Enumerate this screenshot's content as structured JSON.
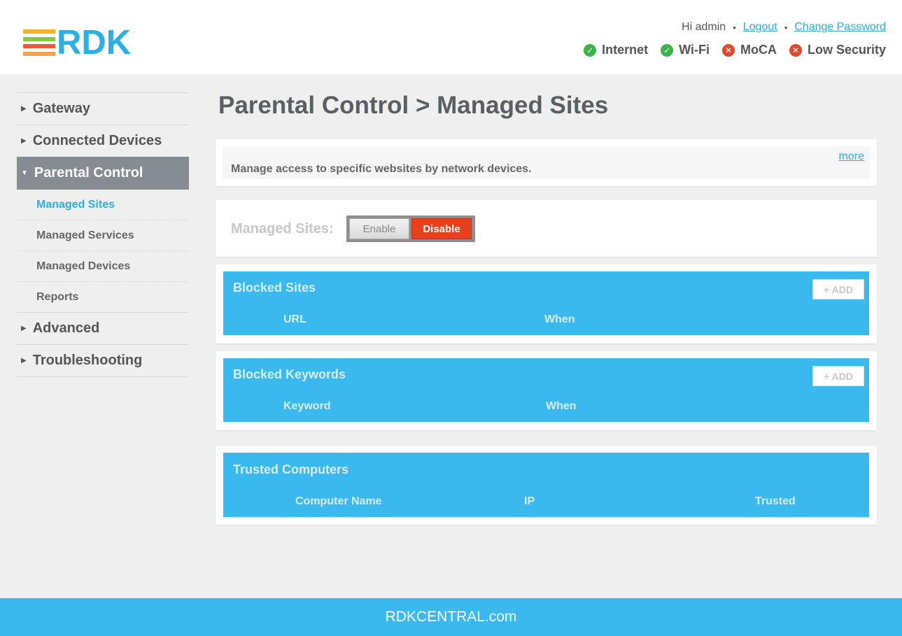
{
  "header": {
    "logo_text": "RDK",
    "logo_colors": [
      "#f7b21d",
      "#8cc63e",
      "#ee5a35",
      "#f4a34a"
    ],
    "greeting": "Hi admin",
    "logout": "Logout",
    "change_password": "Change Password",
    "separator": "•",
    "status": [
      {
        "label": "Internet",
        "state": "ok",
        "icon": "check-circle-icon",
        "color": "#3cb34a"
      },
      {
        "label": "Wi-Fi",
        "state": "ok",
        "icon": "check-circle-icon",
        "color": "#3cb34a"
      },
      {
        "label": "MoCA",
        "state": "error",
        "icon": "x-circle-icon",
        "color": "#e2472d"
      },
      {
        "label": "Low Security",
        "state": "error",
        "icon": "x-circle-icon",
        "color": "#e2472d"
      }
    ]
  },
  "sidebar": {
    "gateway": "Gateway",
    "connected_devices": "Connected Devices",
    "parental_control": "Parental Control",
    "sub": {
      "managed_sites": "Managed Sites",
      "managed_services": "Managed Services",
      "managed_devices": "Managed Devices",
      "reports": "Reports"
    },
    "advanced": "Advanced",
    "troubleshooting": "Troubleshooting"
  },
  "main": {
    "title": "Parental Control > Managed Sites",
    "intro": "Manage access to specific websites by network devices.",
    "more": "more",
    "toggle": {
      "label": "Managed Sites:",
      "enable": "Enable",
      "disable": "Disable",
      "selected": "Disable"
    },
    "blocked_sites": {
      "title": "Blocked Sites",
      "add": "+ ADD",
      "columns": [
        "URL",
        "When"
      ]
    },
    "blocked_keywords": {
      "title": "Blocked Keywords",
      "add": "+ ADD",
      "columns": [
        "Keyword",
        "When"
      ]
    },
    "trusted_computers": {
      "title": "Trusted Computers",
      "columns": [
        "Computer Name",
        "IP",
        "Trusted"
      ]
    }
  },
  "footer": {
    "text": "RDKCENTRAL.com"
  },
  "colors": {
    "accent": "#3ab9ee",
    "active_nav": "#868c91",
    "disable_button": "#e8401a"
  }
}
